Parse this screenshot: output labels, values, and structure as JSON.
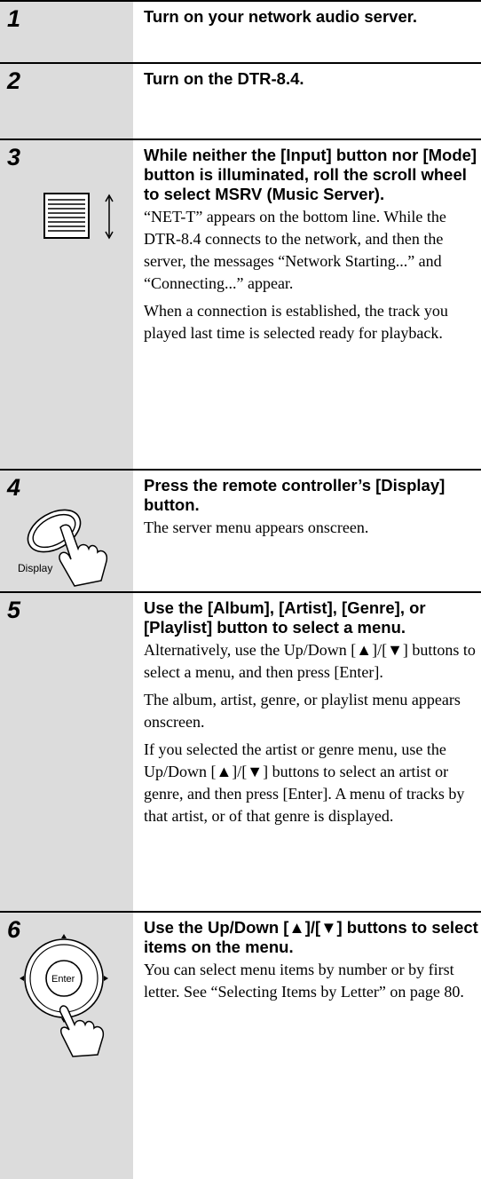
{
  "steps": [
    {
      "num": "1",
      "heading": "Turn on your network audio server."
    },
    {
      "num": "2",
      "heading": "Turn on the DTR-8.4."
    },
    {
      "num": "3",
      "heading": "While neither the [Input] button nor [Mode] button is illuminated, roll the scroll wheel to select MSRV (Music Server).",
      "p1": "“NET-T” appears on the bottom line. While the DTR-8.4 connects to the network, and then the server, the messages “Network Starting...” and “Connecting...” appear.",
      "p2": "When a connection is established, the track you played last time is selected ready for playback."
    },
    {
      "num": "4",
      "heading": "Press the remote controller’s [Display] button.",
      "p1": "The server menu appears onscreen.",
      "icon_label": "Display"
    },
    {
      "num": "5",
      "heading": "Use the [Album], [Artist], [Genre], or [Playlist] button to select a menu.",
      "p1": "Alternatively, use the Up/Down [▲]/[▼] buttons to select a menu, and then press [Enter].",
      "p2": "The album, artist, genre, or playlist menu appears onscreen.",
      "p3": "If you selected the artist or genre menu, use the Up/Down [▲]/[▼] buttons to select an artist or genre, and then press [Enter]. A menu of tracks by that artist, or of that genre is displayed."
    },
    {
      "num": "6",
      "heading": "Use the Up/Down [▲]/[▼] buttons to select items on the menu.",
      "p1": "You can select menu items by number or by first letter. See “Selecting Items by Letter” on page 80.",
      "icon_label": "Enter"
    }
  ]
}
